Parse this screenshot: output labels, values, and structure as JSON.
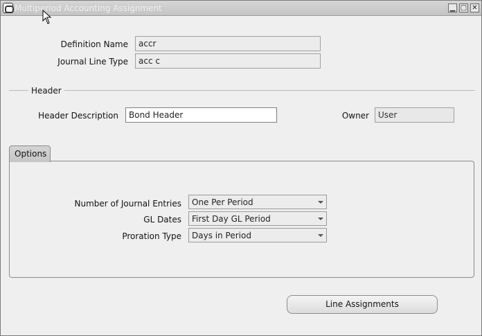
{
  "window": {
    "title": "Multiperiod Accounting Assignment",
    "controls": {
      "minimize": "▁",
      "maximize": "□",
      "close": "✕"
    }
  },
  "definition": {
    "name_label": "Definition Name",
    "name_value": "accr",
    "journal_line_type_label": "Journal Line Type",
    "journal_line_type_value": "acc c"
  },
  "header": {
    "section_title": "Header",
    "description_label": "Header Description",
    "description_value": "Bond Header",
    "owner_label": "Owner",
    "owner_value": "User"
  },
  "tabs": [
    {
      "label": "Options",
      "active": true
    }
  ],
  "options": {
    "num_entries_label": "Number of Journal Entries",
    "num_entries_value": "One Per Period",
    "gl_dates_label": "GL Dates",
    "gl_dates_value": "First Day GL Period",
    "proration_label": "Proration Type",
    "proration_value": "Days in Period"
  },
  "actions": {
    "line_assignments_label": "Line Assignments"
  },
  "icons": {
    "app": "oracle-forms-icon",
    "cursor": "mouse-pointer-icon",
    "dropdown": "dropdown-arrow-icon"
  }
}
